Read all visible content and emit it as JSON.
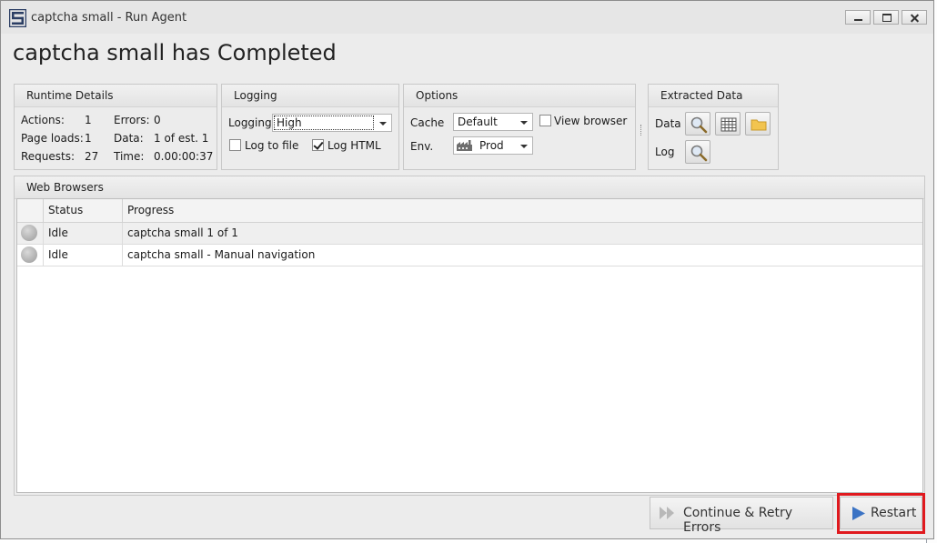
{
  "window": {
    "title": "captcha small - Run Agent"
  },
  "heading": "captcha small  has Completed",
  "runtime": {
    "title": "Runtime Details",
    "actions_label": "Actions:",
    "actions_value": "1",
    "errors_label": "Errors:",
    "errors_value": "0",
    "page_loads_label": "Page loads:",
    "page_loads_value": "1",
    "data_label": "Data:",
    "data_value": "1 of est. 1",
    "requests_label": "Requests:",
    "requests_value": "27",
    "time_label": "Time:",
    "time_value": "0.00:00:37"
  },
  "logging": {
    "title": "Logging",
    "label": "Logging",
    "value": "High",
    "log_to_file_label": "Log to file",
    "log_to_file_checked": false,
    "log_html_label": "Log HTML",
    "log_html_checked": true
  },
  "options": {
    "title": "Options",
    "cache_label": "Cache",
    "cache_value": "Default",
    "view_browser_label": "View browser",
    "view_browser_checked": false,
    "env_label": "Env.",
    "env_value": "Prod",
    "env_icon": "factory-icon"
  },
  "extracted": {
    "title": "Extracted Data",
    "data_label": "Data",
    "log_label": "Log",
    "data_icons": [
      "magnifier-icon",
      "grid-icon",
      "folder-icon"
    ],
    "log_icons": [
      "magnifier-icon"
    ]
  },
  "browsers": {
    "title": "Web Browsers",
    "columns": [
      "Status",
      "Progress"
    ],
    "rows": [
      {
        "status": "Idle",
        "progress": "captcha small 1 of 1"
      },
      {
        "status": "Idle",
        "progress": "captcha small - Manual navigation"
      }
    ]
  },
  "buttons": {
    "continue_label": "Continue & Retry Errors",
    "restart_label": "Restart"
  },
  "colors": {
    "highlight": "#e0191e",
    "play_blue": "#3b73c4",
    "folder_yellow": "#f2c44f"
  }
}
